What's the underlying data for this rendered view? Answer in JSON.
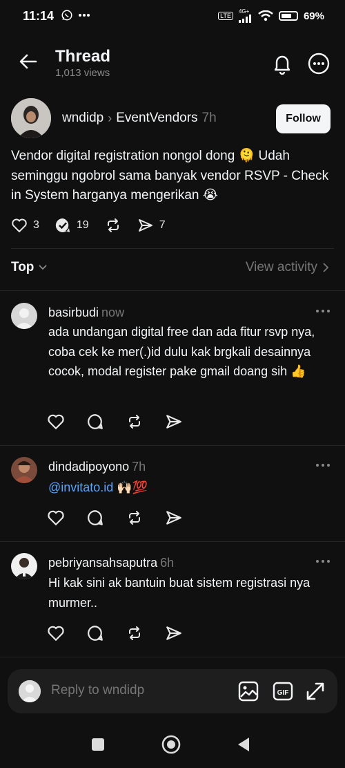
{
  "status_bar": {
    "time": "11:14",
    "network_badge": "LTE",
    "network_type": "4G+",
    "battery_percent": "69%",
    "battery_level": 0.69
  },
  "header": {
    "title": "Thread",
    "views": "1,013 views"
  },
  "post": {
    "author": "wndidp",
    "community": "EventVendors",
    "time": "7h",
    "follow_label": "Follow",
    "text": "Vendor digital registration nongol dong 🫠 Udah seminggu ngobrol sama banyak vendor RSVP - Check in System harganya mengerikan 😭",
    "likes": "3",
    "replies": "19",
    "shares": "7"
  },
  "sort": {
    "label": "Top",
    "view_activity": "View activity"
  },
  "replies": [
    {
      "user": "basirbudi",
      "time": "now",
      "text": "ada undangan digital free dan ada fitur rsvp nya, coba cek ke mer(.)id dulu kak brgkali desainnya cocok, modal register pake gmail doang sih 👍"
    },
    {
      "user": "dindadipoyono",
      "time": "7h",
      "mention": "@invitato.id",
      "text": " 🙌🏻💯"
    },
    {
      "user": "pebriyansahsaputra",
      "time": "6h",
      "text": "Hi kak sini ak bantuin buat sistem registrasi nya murmer.."
    }
  ],
  "composer": {
    "placeholder": "Reply to wndidp"
  },
  "colors": {
    "background": "#101010",
    "text": "#f3f5f7",
    "muted": "#777777",
    "mention": "#5ba3ff",
    "composer_bg": "#1e1e1e"
  }
}
